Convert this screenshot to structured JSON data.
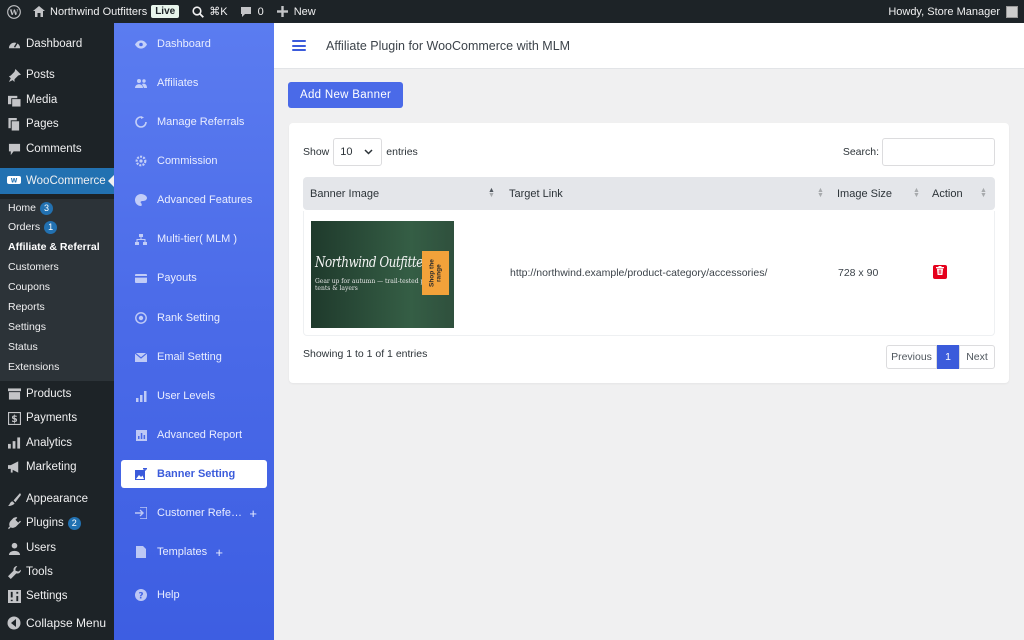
{
  "adminbar": {
    "site_name": "Northwind Outfitters",
    "live_badge": "Live",
    "search_shortcut": "⌘K",
    "comments_count": "0",
    "new_label": "New",
    "greeting": "Howdy, Store Manager"
  },
  "wpmenu": {
    "items": [
      {
        "label": "Dashboard",
        "icon": "dashboard-icon"
      },
      {
        "label": "Posts",
        "icon": "pin-icon"
      },
      {
        "label": "Media",
        "icon": "media-icon"
      },
      {
        "label": "Pages",
        "icon": "pages-icon"
      },
      {
        "label": "Comments",
        "icon": "comment-icon"
      },
      {
        "label": "WooCommerce",
        "icon": "woo-icon"
      },
      {
        "label": "Products",
        "icon": "products-icon"
      },
      {
        "label": "Payments",
        "icon": "payments-icon"
      },
      {
        "label": "Analytics",
        "icon": "analytics-icon"
      },
      {
        "label": "Marketing",
        "icon": "megaphone-icon"
      },
      {
        "label": "Appearance",
        "icon": "brush-icon"
      },
      {
        "label": "Plugins",
        "icon": "plug-icon",
        "badge": "2"
      },
      {
        "label": "Users",
        "icon": "users-icon"
      },
      {
        "label": "Tools",
        "icon": "wrench-icon"
      },
      {
        "label": "Settings",
        "icon": "settings-icon"
      },
      {
        "label": "Collapse Menu",
        "icon": "collapse-icon"
      }
    ],
    "woo_sub": [
      {
        "label": "Home",
        "badge": "3"
      },
      {
        "label": "Orders",
        "badge": "1"
      },
      {
        "label": "Affiliate & Referral"
      },
      {
        "label": "Customers"
      },
      {
        "label": "Coupons"
      },
      {
        "label": "Reports"
      },
      {
        "label": "Settings"
      },
      {
        "label": "Status"
      },
      {
        "label": "Extensions"
      }
    ]
  },
  "plugin_sidebar": {
    "items": [
      {
        "label": "Dashboard",
        "icon": "eye-icon"
      },
      {
        "label": "Affiliates",
        "icon": "people-icon"
      },
      {
        "label": "Manage Referrals",
        "icon": "refresh-icon"
      },
      {
        "label": "Commission",
        "icon": "gear-icon"
      },
      {
        "label": "Advanced Features",
        "icon": "palette-icon"
      },
      {
        "label": "Multi-tier( MLM )",
        "icon": "hierarchy-icon"
      },
      {
        "label": "Payouts",
        "icon": "card-icon"
      },
      {
        "label": "Rank Setting",
        "icon": "target-icon"
      },
      {
        "label": "Email Setting",
        "icon": "envelope-icon"
      },
      {
        "label": "User Levels",
        "icon": "bars-icon"
      },
      {
        "label": "Advanced Report",
        "icon": "report-icon"
      },
      {
        "label": "Banner Setting",
        "icon": "image-icon"
      },
      {
        "label": "Customer Refe…",
        "icon": "signin-icon"
      },
      {
        "label": "Templates",
        "icon": "document-icon"
      },
      {
        "label": "Help",
        "icon": "question-icon"
      }
    ]
  },
  "header": {
    "title": "Affiliate Plugin for WooCommerce with MLM"
  },
  "toolbar": {
    "add_label": "Add New Banner"
  },
  "table": {
    "show_label": "Show",
    "entries_label": "entries",
    "page_length": "10",
    "search_label": "Search:",
    "search_value": "",
    "columns": [
      "Banner Image",
      "Target Link",
      "Image Size",
      "Action"
    ],
    "rows": [
      {
        "banner": {
          "name": "Northwind Outfitters",
          "tagline": "Gear up for autumn — trail-tested packs, tents & layers",
          "cta": "Shop the range"
        },
        "target_link": "http://northwind.example/product-category/accessories/",
        "image_size": "728 x 90"
      }
    ],
    "info": "Showing 1 to 1 of 1 entries",
    "pagination": {
      "prev": "Previous",
      "current": "1",
      "next": "Next"
    }
  },
  "colors": {
    "accent": "#4a6ae8",
    "wp_dark": "#1d2327",
    "woo_active": "#2271b1",
    "delete": "#e5001c"
  }
}
